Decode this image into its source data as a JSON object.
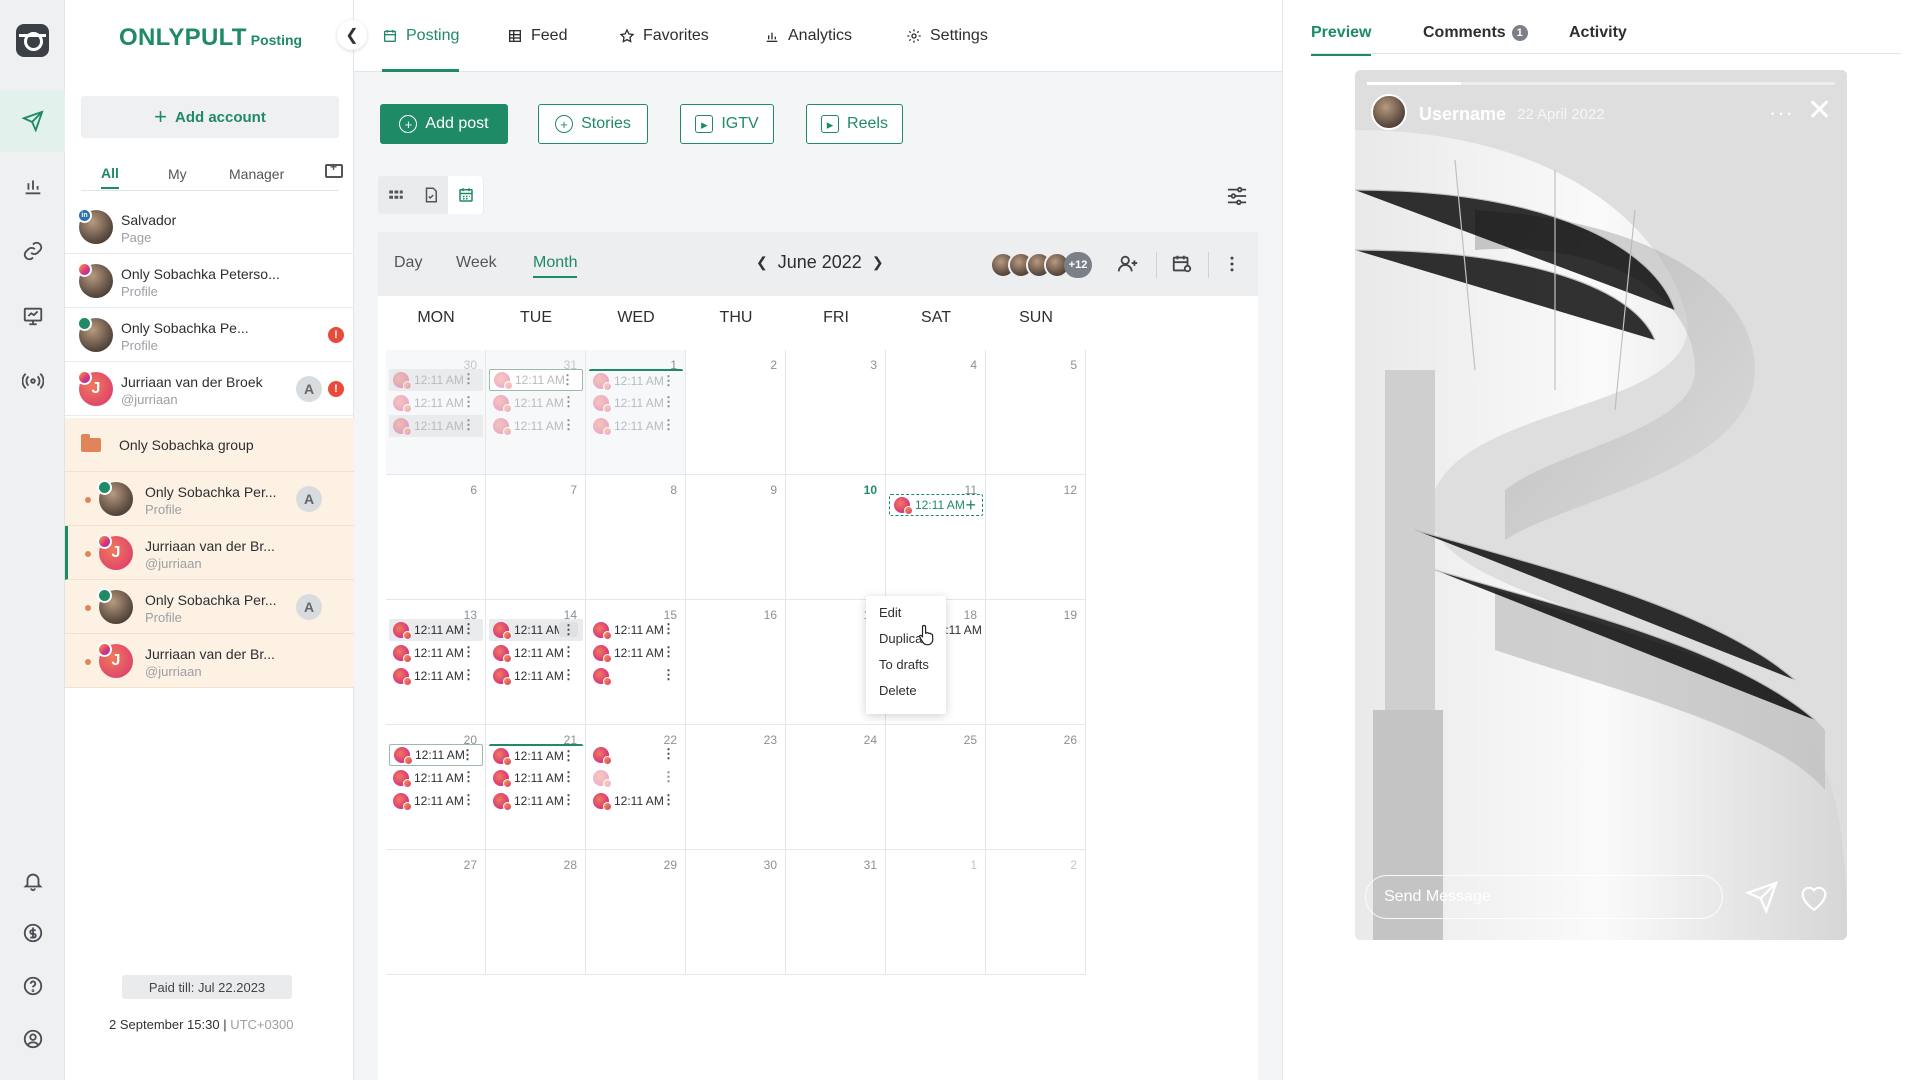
{
  "brand": {
    "name": "ONLYPULT",
    "tag": "Posting"
  },
  "sidebar": {
    "add_account": "Add account",
    "filters": [
      "All",
      "My",
      "Manager"
    ],
    "accounts": [
      {
        "name": "Salvador",
        "sub": "Page",
        "network": "li"
      },
      {
        "name": "Only Sobachka Peterso...",
        "sub": "Profile",
        "network": "ig"
      },
      {
        "name": "Only Sobachka Pe...",
        "sub": "Profile",
        "network": "fb",
        "alert": "!"
      },
      {
        "name": "Jurriaan van der Broek",
        "sub": "@jurriaan",
        "network": "ig",
        "letter": "A",
        "alert": "!"
      }
    ],
    "group": {
      "name": "Only Sobachka group"
    },
    "group_accounts": [
      {
        "name": "Only Sobachka Per...",
        "sub": "Profile",
        "letter": "A"
      },
      {
        "name": "Jurriaan van der Br...",
        "sub": "@jurriaan"
      },
      {
        "name": "Only Sobachka Per...",
        "sub": "Profile",
        "letter": "A"
      },
      {
        "name": "Jurriaan van der Br...",
        "sub": "@jurriaan"
      }
    ],
    "paid_till": "Paid till: Jul 22.2023",
    "clock": "2 September 15:30 |",
    "timezone": "UTC+0300"
  },
  "topnav": [
    "Posting",
    "Feed",
    "Favorites",
    "Analytics",
    "Settings"
  ],
  "toolbar": {
    "add_post": "Add post",
    "stories": "Stories",
    "igtv": "IGTV",
    "reels": "Reels"
  },
  "calendar": {
    "modes": [
      "Day",
      "Week",
      "Month"
    ],
    "active_mode": "Month",
    "title": "June 2022",
    "avatars_more": "+12",
    "weekdays": [
      "MON",
      "TUE",
      "WED",
      "THU",
      "FRI",
      "SAT",
      "SUN"
    ],
    "days": [
      [
        "30",
        "31",
        "1",
        "2",
        "3",
        "4",
        "5"
      ],
      [
        "6",
        "7",
        "8",
        "9",
        "10",
        "11",
        "12"
      ],
      [
        "13",
        "14",
        "15",
        "16",
        "17",
        "18",
        "19"
      ],
      [
        "20",
        "21",
        "22",
        "23",
        "24",
        "25",
        "26"
      ],
      [
        "27",
        "28",
        "29",
        "30",
        "31",
        "1",
        "2"
      ]
    ],
    "post_time": "12:11 AM"
  },
  "context_menu": [
    "Edit",
    "Duplicate",
    "To drafts",
    "Delete"
  ],
  "panel": {
    "tabs": [
      "Preview",
      "Comments",
      "Activity"
    ],
    "comments_count": "1",
    "story": {
      "username": "Username",
      "date": "22 April 2022",
      "message_placeholder": "Send Message",
      "progress": 0.2
    }
  },
  "colors": {
    "accent": "#1f8a66",
    "group_bg": "#fdf1e3",
    "alert": "#e84a3c"
  }
}
